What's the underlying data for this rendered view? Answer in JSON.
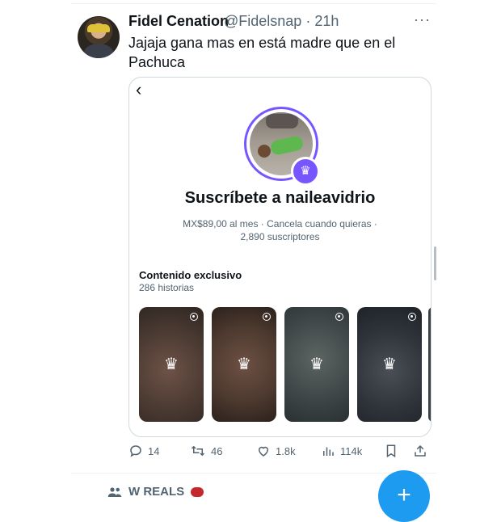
{
  "tweet": {
    "author_name": "Fidel Cenation",
    "handle_time": "@Fidelsnap · 21h",
    "more_glyph": "···",
    "text": "Jajaja gana mas en está madre que en el Pachuca"
  },
  "card": {
    "back_glyph": "‹",
    "title": "Suscríbete a naileavidrio",
    "meta_line1": "MX$89,00 al mes · Cancela cuando quieras ·",
    "meta_line2": "2,890 suscriptores",
    "section_title": "Contenido exclusivo",
    "section_count": "286 historias",
    "crown_glyph": "♛",
    "tile_colors": [
      "#4a3a32",
      "#4e3a30",
      "#3f4748",
      "#2f343a"
    ]
  },
  "actions": {
    "reply_count": "14",
    "retweet_count": "46",
    "like_count": "1.8k",
    "views_count": "114k"
  },
  "community": {
    "label": "W REALS"
  },
  "fab": {
    "glyph": "+"
  },
  "icons": [
    "more-icon",
    "back-icon",
    "crown-icon",
    "reply-icon",
    "retweet-icon",
    "like-icon",
    "views-icon",
    "bookmark-icon",
    "share-icon",
    "people-icon",
    "boxing-glove-icon",
    "plus-icon"
  ],
  "colors": {
    "accent": "#1d9bf0",
    "subscribe_purple": "#7856ff",
    "muted_text": "#536471"
  }
}
